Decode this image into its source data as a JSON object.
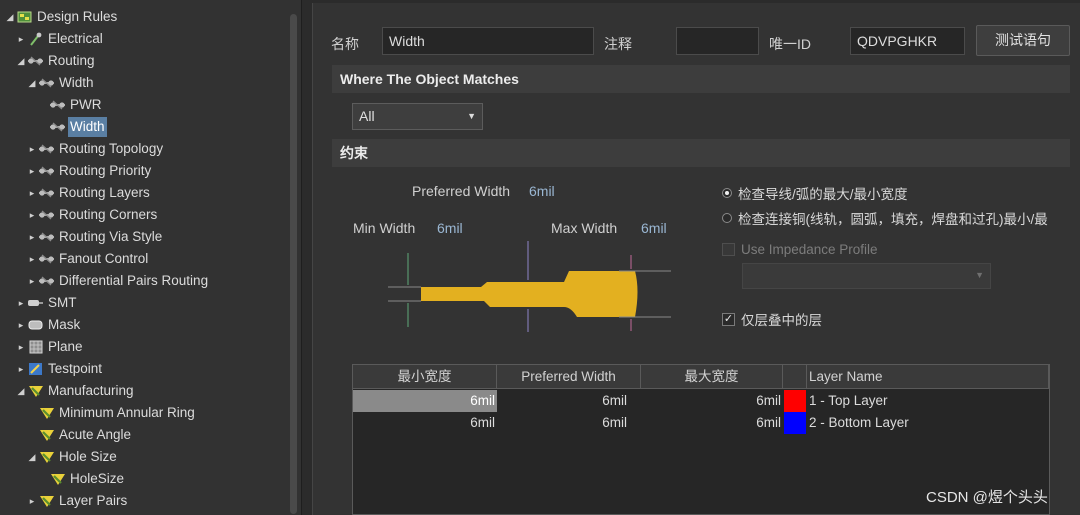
{
  "tree": {
    "items": [
      {
        "label": "Design Rules",
        "depth": 0,
        "arrow": "open",
        "icon": "design-rules-icon"
      },
      {
        "label": "Electrical",
        "depth": 1,
        "arrow": "closed",
        "icon": "electrical-icon"
      },
      {
        "label": "Routing",
        "depth": 1,
        "arrow": "open",
        "icon": "routing-icon"
      },
      {
        "label": "Width",
        "depth": 2,
        "arrow": "open",
        "icon": "routing-icon"
      },
      {
        "label": "PWR",
        "depth": 3,
        "arrow": "none",
        "icon": "routing-icon"
      },
      {
        "label": "Width",
        "depth": 3,
        "arrow": "none",
        "icon": "routing-icon",
        "selected": true
      },
      {
        "label": "Routing Topology",
        "depth": 2,
        "arrow": "closed",
        "icon": "routing-icon"
      },
      {
        "label": "Routing Priority",
        "depth": 2,
        "arrow": "closed",
        "icon": "routing-icon"
      },
      {
        "label": "Routing Layers",
        "depth": 2,
        "arrow": "closed",
        "icon": "routing-icon"
      },
      {
        "label": "Routing Corners",
        "depth": 2,
        "arrow": "closed",
        "icon": "routing-icon"
      },
      {
        "label": "Routing Via Style",
        "depth": 2,
        "arrow": "closed",
        "icon": "routing-icon"
      },
      {
        "label": "Fanout Control",
        "depth": 2,
        "arrow": "closed",
        "icon": "routing-icon"
      },
      {
        "label": "Differential Pairs Routing",
        "depth": 2,
        "arrow": "closed",
        "icon": "routing-icon"
      },
      {
        "label": "SMT",
        "depth": 1,
        "arrow": "closed",
        "icon": "smt-icon"
      },
      {
        "label": "Mask",
        "depth": 1,
        "arrow": "closed",
        "icon": "mask-icon"
      },
      {
        "label": "Plane",
        "depth": 1,
        "arrow": "closed",
        "icon": "plane-icon"
      },
      {
        "label": "Testpoint",
        "depth": 1,
        "arrow": "closed",
        "icon": "testpoint-icon"
      },
      {
        "label": "Manufacturing",
        "depth": 1,
        "arrow": "open",
        "icon": "manufacturing-icon"
      },
      {
        "label": "Minimum Annular Ring",
        "depth": 2,
        "arrow": "none",
        "icon": "manufacturing-icon"
      },
      {
        "label": "Acute Angle",
        "depth": 2,
        "arrow": "none",
        "icon": "manufacturing-icon"
      },
      {
        "label": "Hole Size",
        "depth": 2,
        "arrow": "open",
        "icon": "manufacturing-icon"
      },
      {
        "label": "HoleSize",
        "depth": 3,
        "arrow": "none",
        "icon": "manufacturing-icon"
      },
      {
        "label": "Layer Pairs",
        "depth": 2,
        "arrow": "closed",
        "icon": "manufacturing-icon"
      }
    ]
  },
  "header": {
    "name_label": "名称",
    "name_value": "Width",
    "comment_label": "注释",
    "comment_value": "",
    "id_label": "唯一ID",
    "id_value": "QDVPGHKR",
    "test_button": "测试语句"
  },
  "match": {
    "section_title": "Where The Object Matches",
    "selected": "All"
  },
  "constraints": {
    "section_title": "约束",
    "preferred_label": "Preferred Width",
    "preferred_value": "6mil",
    "min_label": "Min Width",
    "min_value": "6mil",
    "max_label": "Max Width",
    "max_value": "6mil",
    "radio_1": "检查导线/弧的最大/最小宽度",
    "radio_2": "检查连接铜(线轨，圆弧，填充，焊盘和过孔)最小/最",
    "impedance_label": "Use Impedance Profile",
    "layerstack_label": "仅层叠中的层",
    "colors": {
      "trace": "#e3b020",
      "selection": "#5a7fa3"
    }
  },
  "grid": {
    "headers": [
      "最小宽度",
      "Preferred Width",
      "最大宽度",
      "",
      "Layer Name"
    ],
    "rows": [
      {
        "min": "6mil",
        "pref": "6mil",
        "max": "6mil",
        "color": "#ff0000",
        "layer": "1 - Top Layer"
      },
      {
        "min": "6mil",
        "pref": "6mil",
        "max": "6mil",
        "color": "#0000ff",
        "layer": "2 - Bottom Layer"
      }
    ]
  },
  "watermark": "CSDN @煜个头头"
}
